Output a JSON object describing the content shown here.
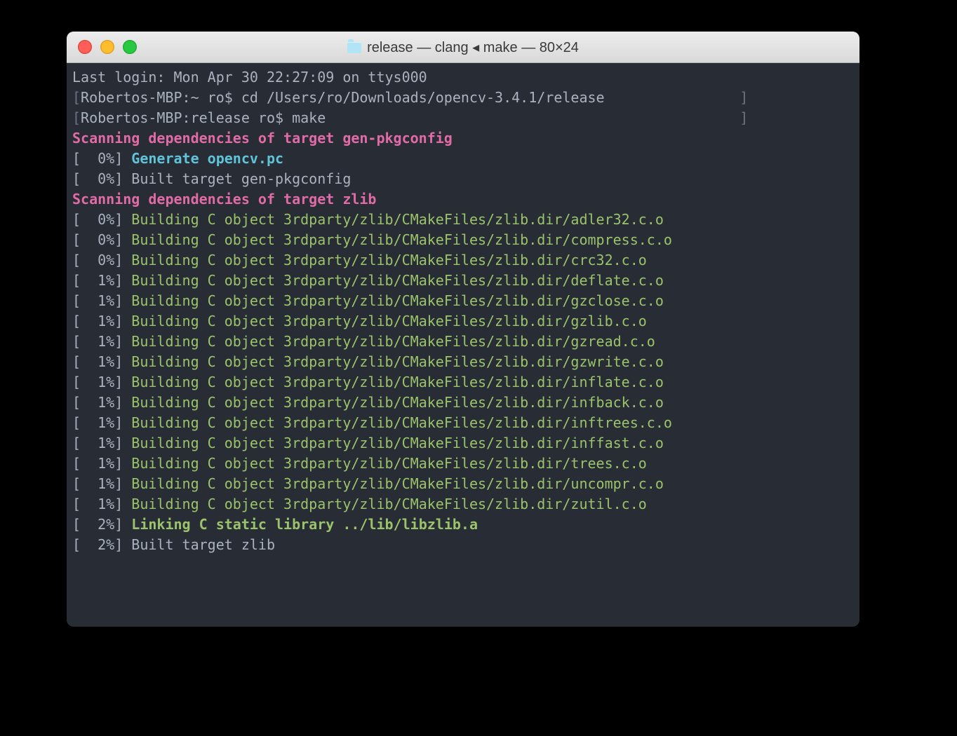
{
  "window": {
    "title": "release — clang ◂ make — 80×24"
  },
  "lines": [
    {
      "segments": [
        {
          "cls": "plain",
          "text": "Last login: Mon Apr 30 22:27:09 on ttys000"
        }
      ]
    },
    {
      "segments": [
        {
          "cls": "dimbr",
          "text": "["
        },
        {
          "cls": "plain",
          "text": "Robertos-MBP:~ ro$ cd /Users/ro/Downloads/opencv-3.4.1/release"
        },
        {
          "cls": "dimbr",
          "text": "                ]"
        }
      ]
    },
    {
      "segments": [
        {
          "cls": "dimbr",
          "text": "["
        },
        {
          "cls": "plain",
          "text": "Robertos-MBP:release ro$ make"
        },
        {
          "cls": "dimbr",
          "text": "                                                 ]"
        }
      ]
    },
    {
      "segments": [
        {
          "cls": "magenta",
          "text": "Scanning dependencies of target gen-pkgconfig"
        }
      ]
    },
    {
      "segments": [
        {
          "cls": "plain",
          "text": "[  0%] "
        },
        {
          "cls": "cyan",
          "text": "Generate opencv.pc"
        }
      ]
    },
    {
      "segments": [
        {
          "cls": "plain",
          "text": "[  0%] Built target gen-pkgconfig"
        }
      ]
    },
    {
      "segments": [
        {
          "cls": "magenta",
          "text": "Scanning dependencies of target zlib"
        }
      ]
    },
    {
      "segments": [
        {
          "cls": "plain",
          "text": "[  0%] "
        },
        {
          "cls": "green",
          "text": "Building C object 3rdparty/zlib/CMakeFiles/zlib.dir/adler32.c.o"
        }
      ]
    },
    {
      "segments": [
        {
          "cls": "plain",
          "text": "[  0%] "
        },
        {
          "cls": "green",
          "text": "Building C object 3rdparty/zlib/CMakeFiles/zlib.dir/compress.c.o"
        }
      ]
    },
    {
      "segments": [
        {
          "cls": "plain",
          "text": "[  0%] "
        },
        {
          "cls": "green",
          "text": "Building C object 3rdparty/zlib/CMakeFiles/zlib.dir/crc32.c.o"
        }
      ]
    },
    {
      "segments": [
        {
          "cls": "plain",
          "text": "[  1%] "
        },
        {
          "cls": "green",
          "text": "Building C object 3rdparty/zlib/CMakeFiles/zlib.dir/deflate.c.o"
        }
      ]
    },
    {
      "segments": [
        {
          "cls": "plain",
          "text": "[  1%] "
        },
        {
          "cls": "green",
          "text": "Building C object 3rdparty/zlib/CMakeFiles/zlib.dir/gzclose.c.o"
        }
      ]
    },
    {
      "segments": [
        {
          "cls": "plain",
          "text": "[  1%] "
        },
        {
          "cls": "green",
          "text": "Building C object 3rdparty/zlib/CMakeFiles/zlib.dir/gzlib.c.o"
        }
      ]
    },
    {
      "segments": [
        {
          "cls": "plain",
          "text": "[  1%] "
        },
        {
          "cls": "green",
          "text": "Building C object 3rdparty/zlib/CMakeFiles/zlib.dir/gzread.c.o"
        }
      ]
    },
    {
      "segments": [
        {
          "cls": "plain",
          "text": "[  1%] "
        },
        {
          "cls": "green",
          "text": "Building C object 3rdparty/zlib/CMakeFiles/zlib.dir/gzwrite.c.o"
        }
      ]
    },
    {
      "segments": [
        {
          "cls": "plain",
          "text": "[  1%] "
        },
        {
          "cls": "green",
          "text": "Building C object 3rdparty/zlib/CMakeFiles/zlib.dir/inflate.c.o"
        }
      ]
    },
    {
      "segments": [
        {
          "cls": "plain",
          "text": "[  1%] "
        },
        {
          "cls": "green",
          "text": "Building C object 3rdparty/zlib/CMakeFiles/zlib.dir/infback.c.o"
        }
      ]
    },
    {
      "segments": [
        {
          "cls": "plain",
          "text": "[  1%] "
        },
        {
          "cls": "green",
          "text": "Building C object 3rdparty/zlib/CMakeFiles/zlib.dir/inftrees.c.o"
        }
      ]
    },
    {
      "segments": [
        {
          "cls": "plain",
          "text": "[  1%] "
        },
        {
          "cls": "green",
          "text": "Building C object 3rdparty/zlib/CMakeFiles/zlib.dir/inffast.c.o"
        }
      ]
    },
    {
      "segments": [
        {
          "cls": "plain",
          "text": "[  1%] "
        },
        {
          "cls": "green",
          "text": "Building C object 3rdparty/zlib/CMakeFiles/zlib.dir/trees.c.o"
        }
      ]
    },
    {
      "segments": [
        {
          "cls": "plain",
          "text": "[  1%] "
        },
        {
          "cls": "green",
          "text": "Building C object 3rdparty/zlib/CMakeFiles/zlib.dir/uncompr.c.o"
        }
      ]
    },
    {
      "segments": [
        {
          "cls": "plain",
          "text": "[  1%] "
        },
        {
          "cls": "green",
          "text": "Building C object 3rdparty/zlib/CMakeFiles/zlib.dir/zutil.c.o"
        }
      ]
    },
    {
      "segments": [
        {
          "cls": "plain",
          "text": "[  2%] "
        },
        {
          "cls": "greenb",
          "text": "Linking C static library ../lib/libzlib.a"
        }
      ]
    },
    {
      "segments": [
        {
          "cls": "plain",
          "text": "[  2%] Built target zlib"
        }
      ]
    }
  ]
}
